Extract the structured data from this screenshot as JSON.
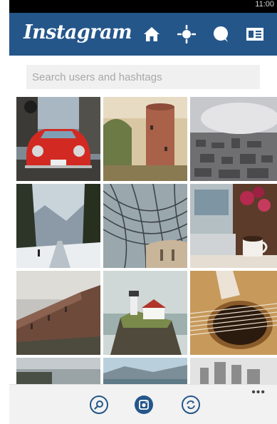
{
  "status_bar": {
    "time": "11:00"
  },
  "header": {
    "logo": "Instagram",
    "bg_color": "#24568a"
  },
  "header_icons": [
    "home-icon",
    "news-icon",
    "comment-icon",
    "profile-icon"
  ],
  "search": {
    "placeholder": "Search users and hashtags",
    "value": ""
  },
  "grid": {
    "tiles": [
      {
        "name": "red-beetle-car-photo"
      },
      {
        "name": "round-stone-tower-photo"
      },
      {
        "name": "city-aerial-view-photo"
      },
      {
        "name": "snowy-mountain-road-photo"
      },
      {
        "name": "glass-dome-ceiling-photo"
      },
      {
        "name": "coffee-and-laptop-photo"
      },
      {
        "name": "old-fortress-wall-photo"
      },
      {
        "name": "lighthouse-cliff-photo"
      },
      {
        "name": "guitar-soundhole-photo"
      },
      {
        "name": "partial-photo-bottom-left"
      },
      {
        "name": "partial-photo-bottom-center"
      },
      {
        "name": "partial-photo-bottom-right"
      }
    ]
  },
  "app_bar": {
    "buttons": [
      "search-icon",
      "camera-icon",
      "refresh-icon"
    ],
    "more": "•••"
  }
}
